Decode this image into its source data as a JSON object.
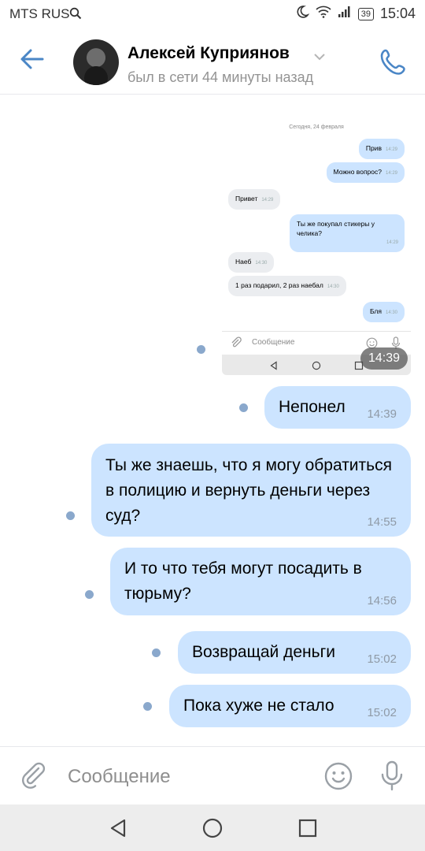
{
  "status_bar": {
    "carrier": "MTS RUS",
    "battery": "39",
    "time": "15:04"
  },
  "header": {
    "name": "Алексей Куприянов",
    "last_seen": "был в сети 44 минуты назад"
  },
  "embedded_screenshot": {
    "date": "Сегодня, 24 февраля",
    "messages": [
      {
        "text": "Прив",
        "time": "14:29"
      },
      {
        "text": "Можно вопрос?",
        "time": "14:29"
      },
      {
        "text": "Привет",
        "time": "14:29"
      },
      {
        "text": "Ты же покупал стикеры у челика?",
        "time": "14:29"
      },
      {
        "text": "Наеб",
        "time": "14:30"
      },
      {
        "text": "1 раз подарил, 2 раз наебал",
        "time": "14:30"
      },
      {
        "text": "Бля",
        "time": "14:30"
      }
    ],
    "input_placeholder": "Сообщение",
    "time": "14:39"
  },
  "messages": [
    {
      "text": "Непонел",
      "time": "14:39"
    },
    {
      "text": "Ты же знаешь, что я могу обратиться в полицию и вернуть деньги через суд?",
      "time": "14:55"
    },
    {
      "text": "И то что тебя могут посадить в тюрьму?",
      "time": "14:56"
    },
    {
      "text": "Возвращай деньги",
      "time": "15:02"
    },
    {
      "text": "Пока хуже не стало",
      "time": "15:02"
    }
  ],
  "input": {
    "placeholder": "Сообщение"
  },
  "colors": {
    "accent": "#4a86c6",
    "bubble_out": "#cce4ff",
    "bubble_in": "#ebedf0",
    "unread_dot": "#8aa8cc"
  }
}
